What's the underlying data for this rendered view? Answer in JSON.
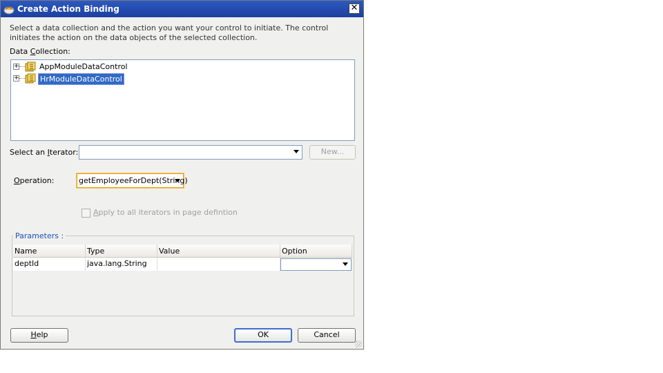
{
  "dialog": {
    "title": "Create Action Binding",
    "close_symbol": "✕",
    "description": "Select a data collection and the action you want your control to initiate. The control initiates the action on the data objects of the selected collection."
  },
  "data_collection": {
    "label_prefix": "Data ",
    "label_mnemonic": "C",
    "label_suffix": "ollection:",
    "items": [
      {
        "label": "AppModuleDataControl",
        "icon": "data-control-icon",
        "expander": "+"
      },
      {
        "label": "HrModuleDataControl",
        "icon": "data-control-icon",
        "expander": "+",
        "selected": true
      }
    ]
  },
  "iterator": {
    "label_prefix": "Select an ",
    "label_mnemonic": "I",
    "label_suffix": "terator:",
    "value": "",
    "new_button": "New..."
  },
  "operation": {
    "label_mnemonic": "O",
    "label_suffix": "peration:",
    "value": "getEmployeeForDept(String)"
  },
  "apply_all": {
    "label_mnemonic": "A",
    "label_suffix": "pply to all iterators in page defintion",
    "checked": false
  },
  "parameters": {
    "title": "Parameters :",
    "columns": [
      "Name",
      "Type",
      "Value",
      "Option"
    ],
    "rows": [
      {
        "name": "deptId",
        "type": "java.lang.String",
        "value": "",
        "option": ""
      }
    ]
  },
  "buttons": {
    "help_mnemonic": "H",
    "help_suffix": "elp",
    "ok": "OK",
    "cancel": "Cancel"
  },
  "colors": {
    "titlebar": "#1c3f9f",
    "selection": "#316ac5",
    "group_title": "#1b4fbf",
    "operation_focus": "#e3a21a"
  }
}
